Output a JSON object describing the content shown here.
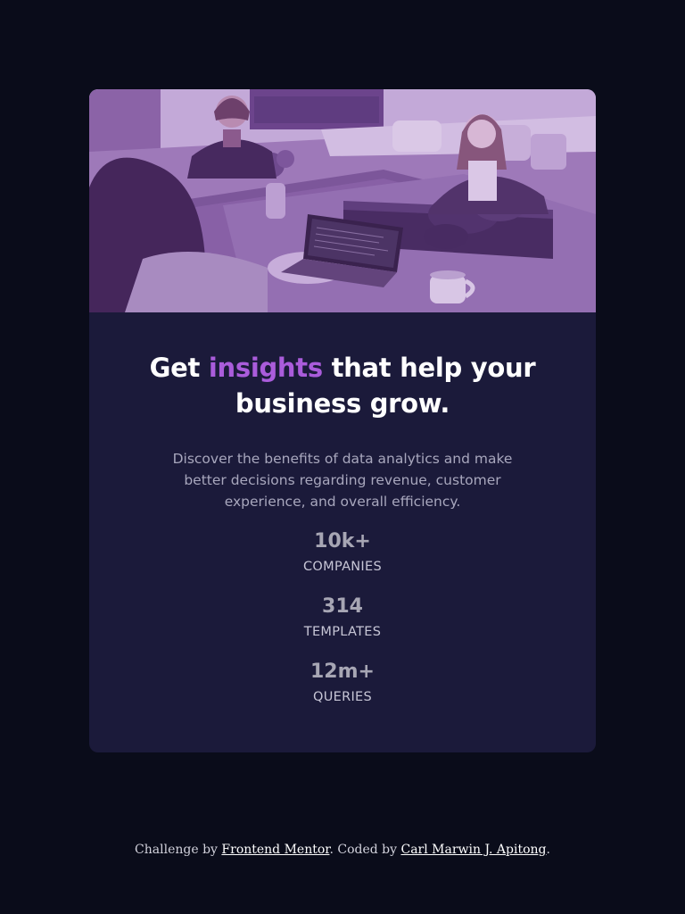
{
  "hero": {
    "alt": "People working at a shared table with laptops"
  },
  "headline": {
    "part1": "Get ",
    "accent": "insights",
    "part2": " that help your business grow."
  },
  "description": "Discover the benefits of data analytics and make better decisions regarding revenue, customer experience, and overall efficiency.",
  "stats": [
    {
      "value": "10k+",
      "label": "COMPANIES"
    },
    {
      "value": "314",
      "label": "TEMPLATES"
    },
    {
      "value": "12m+",
      "label": "QUERIES"
    }
  ],
  "footer": {
    "prefix": "Challenge by ",
    "link1": "Frontend Mentor",
    "middle": ". Coded by ",
    "link2": "Carl Marwin J. Apitong",
    "suffix": "."
  },
  "colors": {
    "page_bg": "#0a0c1a",
    "card_bg": "#1b1a3a",
    "accent": "#aa5cdb",
    "image_tint": "#7a4aa6"
  }
}
